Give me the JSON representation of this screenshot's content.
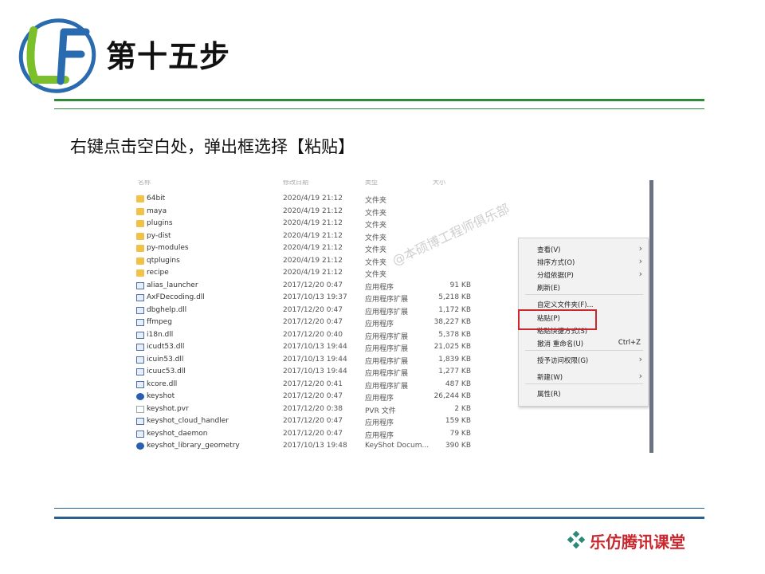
{
  "slide": {
    "title": "第十五步",
    "subtitle": "右键点击空白处，弹出框选择【粘贴】",
    "brand": "乐仿腾讯课堂",
    "logo_letters": "LF"
  },
  "explorer": {
    "headers": [
      "名称",
      "修改日期",
      "类型",
      "大小"
    ],
    "watermark": "@本硕博工程师俱乐部",
    "files": [
      {
        "name": "64bit",
        "date": "2020/4/19 21:12",
        "type": "文件夹",
        "size": "",
        "icon": "folder-icon"
      },
      {
        "name": "maya",
        "date": "2020/4/19 21:12",
        "type": "文件夹",
        "size": "",
        "icon": "folder-icon"
      },
      {
        "name": "plugins",
        "date": "2020/4/19 21:12",
        "type": "文件夹",
        "size": "",
        "icon": "folder-icon"
      },
      {
        "name": "py-dist",
        "date": "2020/4/19 21:12",
        "type": "文件夹",
        "size": "",
        "icon": "folder-icon"
      },
      {
        "name": "py-modules",
        "date": "2020/4/19 21:12",
        "type": "文件夹",
        "size": "",
        "icon": "folder-icon"
      },
      {
        "name": "qtplugins",
        "date": "2020/4/19 21:12",
        "type": "文件夹",
        "size": "",
        "icon": "folder-icon"
      },
      {
        "name": "recipe",
        "date": "2020/4/19 21:12",
        "type": "文件夹",
        "size": "",
        "icon": "folder-icon"
      },
      {
        "name": "alias_launcher",
        "date": "2017/12/20 0:47",
        "type": "应用程序",
        "size": "91 KB",
        "icon": "exe-icon"
      },
      {
        "name": "AxFDecoding.dll",
        "date": "2017/10/13 19:37",
        "type": "应用程序扩展",
        "size": "5,218 KB",
        "icon": "dll-icon"
      },
      {
        "name": "dbghelp.dll",
        "date": "2017/12/20 0:47",
        "type": "应用程序扩展",
        "size": "1,172 KB",
        "icon": "dll-icon"
      },
      {
        "name": "ffmpeg",
        "date": "2017/12/20 0:47",
        "type": "应用程序",
        "size": "38,227 KB",
        "icon": "exe-icon"
      },
      {
        "name": "i18n.dll",
        "date": "2017/12/20 0:40",
        "type": "应用程序扩展",
        "size": "5,378 KB",
        "icon": "dll-icon"
      },
      {
        "name": "icudt53.dll",
        "date": "2017/10/13 19:44",
        "type": "应用程序扩展",
        "size": "21,025 KB",
        "icon": "dll-icon"
      },
      {
        "name": "icuin53.dll",
        "date": "2017/10/13 19:44",
        "type": "应用程序扩展",
        "size": "1,839 KB",
        "icon": "dll-icon"
      },
      {
        "name": "icuuc53.dll",
        "date": "2017/10/13 19:44",
        "type": "应用程序扩展",
        "size": "1,277 KB",
        "icon": "dll-icon"
      },
      {
        "name": "kcore.dll",
        "date": "2017/12/20 0:41",
        "type": "应用程序扩展",
        "size": "487 KB",
        "icon": "dll-icon"
      },
      {
        "name": "keyshot",
        "date": "2017/12/20 0:47",
        "type": "应用程序",
        "size": "26,244 KB",
        "icon": "keyshot-icon"
      },
      {
        "name": "keyshot.pvr",
        "date": "2017/12/20 0:38",
        "type": "PVR 文件",
        "size": "2 KB",
        "icon": "file-icon"
      },
      {
        "name": "keyshot_cloud_handler",
        "date": "2017/12/20 0:47",
        "type": "应用程序",
        "size": "159 KB",
        "icon": "exe-icon"
      },
      {
        "name": "keyshot_daemon",
        "date": "2017/12/20 0:47",
        "type": "应用程序",
        "size": "79 KB",
        "icon": "exe-icon"
      },
      {
        "name": "keyshot_library_geometry",
        "date": "2017/10/13 19:48",
        "type": "KeyShot Docum...",
        "size": "390 KB",
        "icon": "keyshot-icon"
      }
    ]
  },
  "context_menu": {
    "items": [
      {
        "label": "查看(V)",
        "shortcut": "",
        "submenu": true
      },
      {
        "label": "排序方式(O)",
        "shortcut": "",
        "submenu": true
      },
      {
        "label": "分组依据(P)",
        "shortcut": "",
        "submenu": true
      },
      {
        "label": "刷新(E)",
        "shortcut": "",
        "submenu": false
      },
      {
        "label": "自定义文件夹(F)...",
        "shortcut": "",
        "submenu": false
      },
      {
        "label": "粘贴(P)",
        "shortcut": "",
        "submenu": false
      },
      {
        "label": "粘贴快捷方式(S)",
        "shortcut": "",
        "submenu": false
      },
      {
        "label": "撤消 重命名(U)",
        "shortcut": "Ctrl+Z",
        "submenu": false
      },
      {
        "label": "授予访问权限(G)",
        "shortcut": "",
        "submenu": true
      },
      {
        "label": "新建(W)",
        "shortcut": "",
        "submenu": true
      },
      {
        "label": "属性(R)",
        "shortcut": "",
        "submenu": false
      }
    ],
    "highlighted": "粘贴(P)"
  },
  "colors": {
    "green_rule": "#2f8a3a",
    "blue_rule": "#2a5f8f",
    "highlight_box": "#c8282e",
    "folder": "#f0c24a"
  }
}
